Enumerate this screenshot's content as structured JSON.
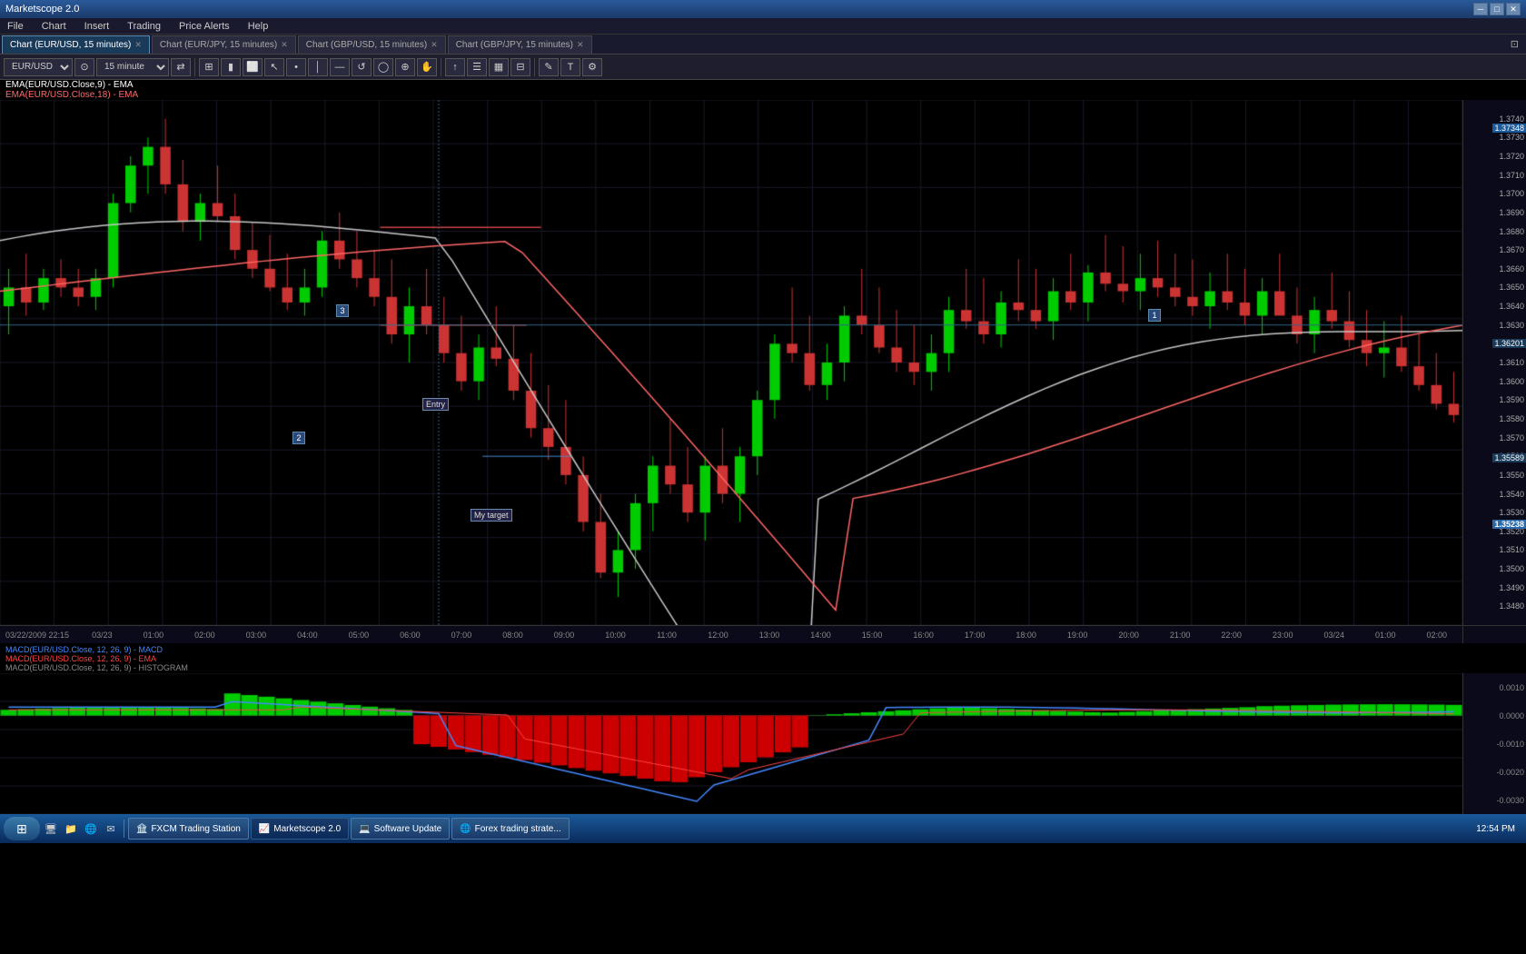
{
  "app": {
    "title": "Marketscope 2.0",
    "version": "2.0"
  },
  "titleBar": {
    "title": "Marketscope 2.0",
    "controls": [
      "minimize",
      "maximize",
      "close"
    ]
  },
  "menuBar": {
    "items": [
      "File",
      "Chart",
      "Insert",
      "Trading",
      "Price Alerts",
      "Help"
    ]
  },
  "tabs": [
    {
      "label": "Chart (EUR/USD, 15 minutes)",
      "active": true,
      "closeable": true
    },
    {
      "label": "Chart (EUR/JPY, 15 minutes)",
      "active": false,
      "closeable": true
    },
    {
      "label": "Chart (GBP/USD, 15 minutes)",
      "active": false,
      "closeable": true
    },
    {
      "label": "Chart (GBP/JPY, 15 minutes)",
      "active": false,
      "closeable": true
    }
  ],
  "toolbar": {
    "symbol": "EUR/USD",
    "timeframe": "15 minute",
    "buttons": [
      "chart-type",
      "bar",
      "candle",
      "line",
      "cursor",
      "crosshair",
      "zoom",
      "hand",
      "magnet"
    ]
  },
  "indicators": {
    "ema1": "EMA(EUR/USD.Close,9) - EMA",
    "ema2": "EMA(EUR/USD.Close,18) - EMA"
  },
  "macdLabels": {
    "line1": "MACD(EUR/USD.Close, 12, 26, 9) - MACD",
    "line2": "MACD(EUR/USD.Close, 12, 26, 9) - EMA",
    "line3": "MACD(EUR/USD.Close, 12, 26, 9) - HISTOGRAM"
  },
  "priceAxis": {
    "highlighted": "1.37348",
    "prices": [
      {
        "value": "1.3740",
        "pct": 2
      },
      {
        "value": "1.3730",
        "pct": 5
      },
      {
        "value": "1.3720",
        "pct": 9
      },
      {
        "value": "1.3710",
        "pct": 13
      },
      {
        "value": "1.3700",
        "pct": 17
      },
      {
        "value": "1.3690",
        "pct": 21
      },
      {
        "value": "1.3680",
        "pct": 25
      },
      {
        "value": "1.3670",
        "pct": 29
      },
      {
        "value": "1.3660",
        "pct": 33
      },
      {
        "value": "1.3650",
        "pct": 37
      },
      {
        "value": "1.3640",
        "pct": 41
      },
      {
        "value": "1.3630",
        "pct": 45
      },
      {
        "value": "1.3620",
        "pct": 49
      },
      {
        "value": "1.3610",
        "pct": 53
      },
      {
        "value": "1.3600",
        "pct": 57
      },
      {
        "value": "1.3590",
        "pct": 61
      },
      {
        "value": "1.3580",
        "pct": 65
      },
      {
        "value": "1.3570",
        "pct": 69
      },
      {
        "value": "1.3560",
        "pct": 73
      },
      {
        "value": "1.3550",
        "pct": 75
      },
      {
        "value": "1.3540",
        "pct": 78
      },
      {
        "value": "1.3530",
        "pct": 81
      },
      {
        "value": "1.3520",
        "pct": 83
      },
      {
        "value": "1.3510",
        "pct": 86
      },
      {
        "value": "1.3500",
        "pct": 89
      },
      {
        "value": "1.3490",
        "pct": 92
      },
      {
        "value": "1.3480",
        "pct": 95
      }
    ],
    "currentPrice": "1.35238",
    "specialPrice1": "1.36201",
    "specialPrice2": "1.35589"
  },
  "timeAxis": {
    "startDate": "03/22/2009 22:15",
    "labels": [
      "03/23",
      "01:00",
      "02:00",
      "03:00",
      "04:00",
      "05:00",
      "06:00",
      "07:00",
      "08:00",
      "09:00",
      "10:00",
      "11:00",
      "12:00",
      "13:00",
      "14:00",
      "15:00",
      "16:00",
      "17:00",
      "18:00",
      "19:00",
      "20:00",
      "21:00",
      "22:00",
      "23:00",
      "03/24",
      "01:00",
      "02:00"
    ]
  },
  "annotations": {
    "entry": "Entry",
    "target": "My target",
    "badges": [
      "3",
      "2",
      "1",
      "1"
    ]
  },
  "macdAxis": {
    "values": [
      "0.0010",
      "0.0000",
      "-0.0010",
      "-0.0020",
      "-0.0030"
    ]
  },
  "taskbar": {
    "startButton": "⊞",
    "apps": [
      {
        "label": "FXCM Trading Station",
        "icon": "🏦"
      },
      {
        "label": "Marketscope 2.0",
        "icon": "📈",
        "active": true
      },
      {
        "label": "Software Update",
        "icon": "💻"
      },
      {
        "label": "Forex trading strate...",
        "icon": "🌐"
      }
    ],
    "clock": "12:54 PM"
  },
  "colors": {
    "background": "#000000",
    "bullCandle": "#00cc00",
    "bearCandle": "#cc0000",
    "ema1Line": "#c8c8c8",
    "ema2Line": "#ff6666",
    "macdLine": "#4488ff",
    "signalLine": "#ff4444",
    "histogramBull": "#00cc00",
    "histogramBear": "#cc0000",
    "accent": "#1a5a9a",
    "gridLine": "#1a1a2a"
  }
}
